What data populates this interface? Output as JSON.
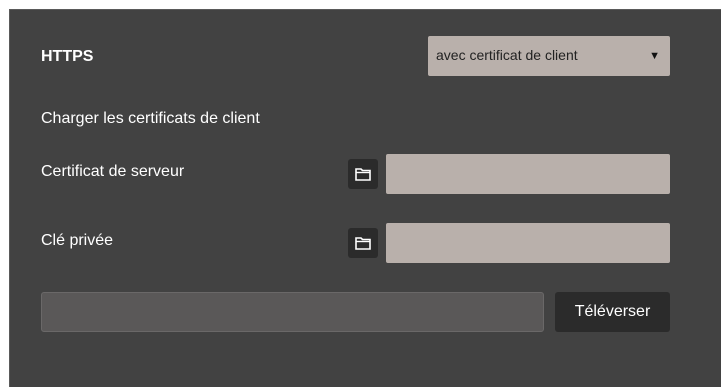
{
  "https": {
    "label": "HTTPS",
    "select": {
      "selected": "avec certificat de client",
      "arrow": "▼"
    }
  },
  "client_certs": {
    "heading": "Charger les certificats de client"
  },
  "server_cert": {
    "label": "Certificat de serveur",
    "icon": "folder-icon",
    "value": ""
  },
  "private_key": {
    "label": "Clé privée",
    "icon": "folder-icon",
    "value": ""
  },
  "upload": {
    "value": "",
    "button_label": "Téléverser"
  },
  "colors": {
    "panel_bg": "#424242",
    "field_bg": "#b9b0ab",
    "button_bg": "#2b2b2b",
    "text": "#ffffff"
  }
}
